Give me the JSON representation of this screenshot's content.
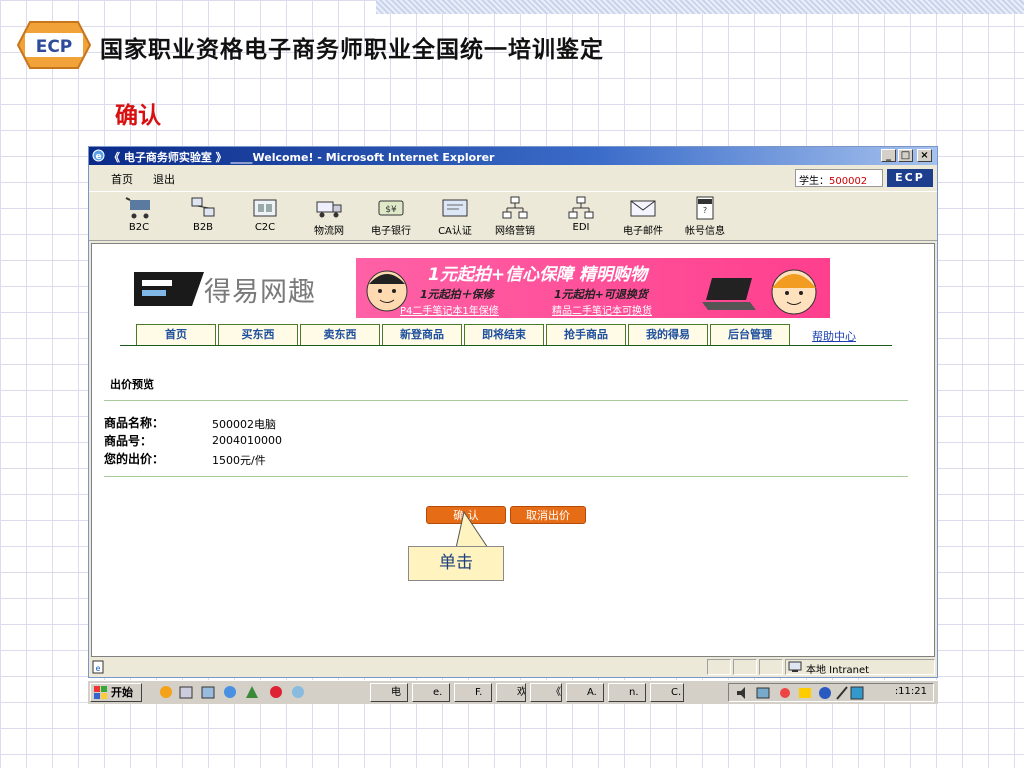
{
  "slide": {
    "title": "国家职业资格电子商务师职业全国统一培训鉴定",
    "subtitle": "确认",
    "logo_text": "ECP"
  },
  "window": {
    "title": "《 电子商务师实验室 》 ____Welcome! - Microsoft Internet Explorer",
    "controls": {
      "minimize": "_",
      "maximize": "□",
      "close": "×"
    }
  },
  "menubar": {
    "items": [
      "首页",
      "退出"
    ],
    "student_label": "学生：",
    "student_id": "500002",
    "ecp_badge": "ECP"
  },
  "toolbar": {
    "items": [
      {
        "label": "B2C",
        "icon": "shopping-cart-icon"
      },
      {
        "label": "B2B",
        "icon": "b2b-network-icon"
      },
      {
        "label": "C2C",
        "icon": "c2c-icon"
      },
      {
        "label": "物流网",
        "icon": "truck-icon"
      },
      {
        "label": "电子银行",
        "icon": "bank-money-icon"
      },
      {
        "label": "CA认证",
        "icon": "certificate-icon"
      },
      {
        "label": "网络营销",
        "icon": "marketing-network-icon"
      },
      {
        "label": "EDI",
        "icon": "edi-network-icon"
      },
      {
        "label": "电子邮件",
        "icon": "email-icon"
      },
      {
        "label": "帐号信息",
        "icon": "help-account-icon"
      }
    ]
  },
  "site": {
    "logo_text": "得易网趣",
    "banner": {
      "headline": "1元起拍+信心保障 精明购物",
      "sub1": "1元起拍＋保修",
      "sub2": "1元起拍+可退换货",
      "link1": "P4二手笔记本1年保修",
      "link2": "精品二手笔记本可换货"
    },
    "nav": [
      "首页",
      "买东西",
      "卖东西",
      "新登商品",
      "即将结束",
      "抢手商品",
      "我的得易",
      "后台管理"
    ],
    "help": "帮助中心"
  },
  "preview": {
    "section_title": "出价预览",
    "rows": [
      {
        "label": "商品名称：",
        "value": "500002电脑"
      },
      {
        "label": "商品号：",
        "value": "2004010000"
      },
      {
        "label": "您的出价：",
        "value": "1500元/件"
      }
    ],
    "confirm_label": "确 认",
    "cancel_label": "取消出价"
  },
  "statusbar": {
    "zone": "本地 Intranet"
  },
  "taskbar": {
    "start_label": "开始",
    "tasks": [
      "电",
      "e.",
      "F.",
      "欢",
      "《",
      "A.",
      "n.",
      "C."
    ],
    "clock": ":11:21"
  },
  "callout": {
    "text": "单击"
  },
  "colors": {
    "accent_orange": "#e76c16",
    "title_red": "#d81010",
    "banner_pink": "#ff3f8e",
    "titlebar_blue": "#0a2a88"
  }
}
